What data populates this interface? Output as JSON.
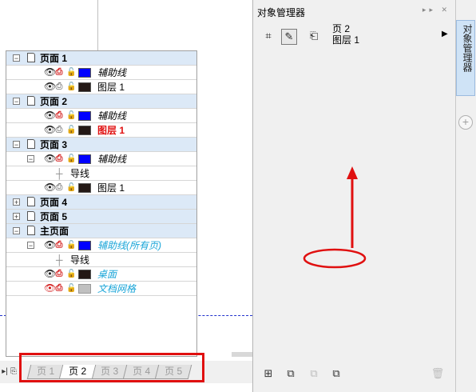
{
  "page_tabs": [
    "页 1",
    "页 2",
    "页 3",
    "页 4",
    "页 5"
  ],
  "docker": {
    "title": "对象管理器",
    "current_page": "页 2",
    "current_layer": "图层 1",
    "side_tab": "对象管理器"
  },
  "tree": {
    "page1": {
      "label": "页面 1",
      "layers": [
        "辅助线",
        "图层 1"
      ]
    },
    "page2": {
      "label": "页面 2",
      "layers": [
        "辅助线",
        "图层 1"
      ]
    },
    "page3": {
      "label": "页面 3",
      "guides_layer": "辅助线",
      "guide_item": "导线",
      "layer": "图层 1"
    },
    "page4": {
      "label": "页面 4"
    },
    "page5": {
      "label": "页面 5"
    },
    "master": {
      "label": "主页面",
      "guides_layer": "辅助线(所有页)",
      "guide_item": "导线",
      "desktop": "桌面",
      "grid": "文档网格"
    }
  },
  "colors": {
    "highlight_red": "#e01010",
    "blue_swatch": "#0000ff",
    "dark_swatch": "#231815",
    "grey_swatch": "#c0c0c0",
    "cyan_text": "#1aa5d8"
  },
  "icons": [
    "new-layer-icon",
    "new-master-layer-icon",
    "new-master-all-icon",
    "new-master-odd-even-icon",
    "delete-icon",
    "eye-icon",
    "printer-icon",
    "lock-icon"
  ]
}
